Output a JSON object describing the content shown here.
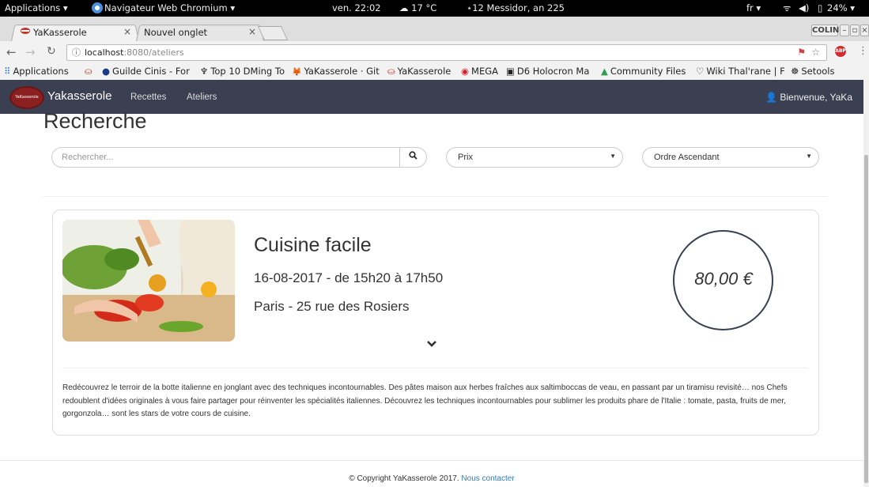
{
  "gnome": {
    "applications": "Applications ▾",
    "window_title": "Navigateur Web Chromium ▾",
    "clock": "ven. 22:02",
    "weather": "☁ 17 °C",
    "calendar": "⋆12 Messidor, an 225",
    "lang": "fr ▾",
    "battery": "24% ▾"
  },
  "tabs": [
    {
      "label": "YaKasserole",
      "close": "×"
    },
    {
      "label": "Nouvel onglet",
      "close": "×"
    }
  ],
  "profile": "COLIN",
  "address": {
    "host": "localhost",
    "rest": ":8080/ateliers"
  },
  "bookmarks": [
    {
      "icon": "⠿",
      "label": "Applications"
    },
    {
      "icon": "⛀",
      "label": ""
    },
    {
      "icon": "●",
      "label": "Guilde Cinis - For"
    },
    {
      "icon": "♆",
      "label": "Top 10 DMing To"
    },
    {
      "icon": "🦊",
      "label": "YaKasserole · Git"
    },
    {
      "icon": "⛀",
      "label": "YaKasserole"
    },
    {
      "icon": "◉",
      "label": "MEGA"
    },
    {
      "icon": "▣",
      "label": "D6 Holocron Ma"
    },
    {
      "icon": "▲",
      "label": "Community Files"
    },
    {
      "icon": "♡",
      "label": "Wiki Thal'rane | F"
    },
    {
      "icon": "☸",
      "label": "Setools"
    }
  ],
  "site": {
    "logo_text": "YaKasserole",
    "brand": "Yakasserole",
    "nav": [
      "Recettes",
      "Ateliers"
    ],
    "welcome": "Bienvenue, YaKa"
  },
  "page": {
    "title": "Recherche",
    "search_placeholder": "Rechercher...",
    "filter_price": "Prix",
    "filter_order": "Ordre Ascendant"
  },
  "card": {
    "title": "Cuisine facile",
    "date": "16-08-2017 - de 15h20 à 17h50",
    "place": "Paris - 25 rue des Rosiers",
    "price": "80,00 €",
    "description": "Redécouvrez le terroir de la botte italienne en jonglant avec des techniques incontournables. Des pâtes maison aux herbes fraîches aux saltimboccas de veau, en passant par un tiramisu revisité… nos Chefs redoublent d'idées originales à vous faire partager pour réinventer les spécialités italiennes. Découvrez les techniques incontournables pour sublimer les produits phare de l'Italie : tomate, pasta, fruits de mer, gorgonzola… sont les stars de votre cours de cuisine."
  },
  "footer": {
    "copyright": "© Copyright YaKasserole 2017.",
    "contact": "Nous contacter"
  },
  "colors": {
    "navbar": "#3a3f51",
    "link": "#337ab7"
  }
}
